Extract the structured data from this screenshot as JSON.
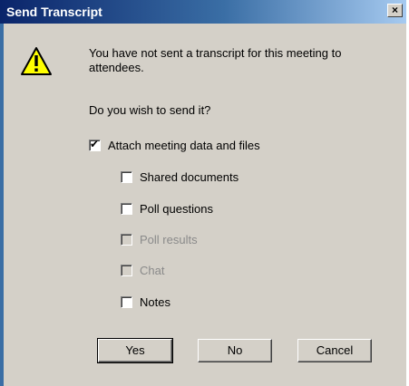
{
  "window": {
    "title": "Send Transcript",
    "close_glyph": "×"
  },
  "message": {
    "text": "You have not sent a transcript for this meeting to attendees.",
    "question": "Do you wish to send it?",
    "icon": "warning-icon"
  },
  "options": {
    "attach": {
      "label": "Attach meeting data and files",
      "checked": true,
      "enabled": true
    },
    "items": [
      {
        "label": "Shared documents",
        "checked": false,
        "enabled": true
      },
      {
        "label": "Poll questions",
        "checked": false,
        "enabled": true
      },
      {
        "label": "Poll results",
        "checked": false,
        "enabled": false
      },
      {
        "label": "Chat",
        "checked": false,
        "enabled": false
      },
      {
        "label": "Notes",
        "checked": false,
        "enabled": true
      }
    ]
  },
  "buttons": {
    "yes": "Yes",
    "no": "No",
    "cancel": "Cancel"
  },
  "colors": {
    "titlebar_start": "#0a246a",
    "titlebar_end": "#a6caf0",
    "dialog_face": "#d4d0c8",
    "disabled_text": "#8a8a8a"
  }
}
